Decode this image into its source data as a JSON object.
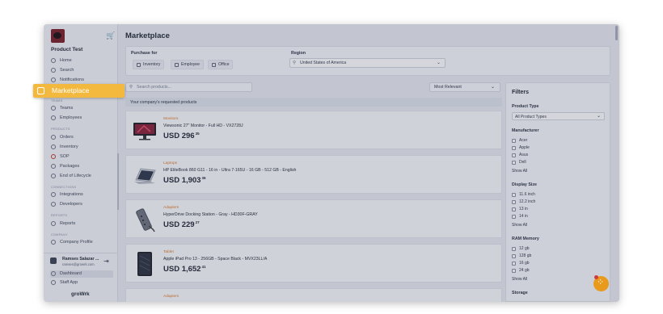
{
  "sidebar": {
    "org_name": "Product Test",
    "items_top": [
      {
        "label": "Home",
        "icon": "home-icon"
      },
      {
        "label": "Search",
        "icon": "search-icon"
      },
      {
        "label": "Notifications",
        "icon": "bell-icon"
      }
    ],
    "sections": [
      {
        "title": "TEAMS",
        "items": [
          {
            "label": "Teams",
            "icon": "people-icon"
          },
          {
            "label": "Employees",
            "icon": "user-icon"
          }
        ]
      },
      {
        "title": "PRODUCTS",
        "items": [
          {
            "label": "Orders",
            "icon": "orders-icon"
          },
          {
            "label": "Inventory",
            "icon": "laptop-icon"
          },
          {
            "label": "SOP",
            "icon": "sop-icon"
          },
          {
            "label": "Packages",
            "icon": "package-icon"
          },
          {
            "label": "End of Lifecycle",
            "icon": "cycle-icon"
          }
        ]
      },
      {
        "title": "CONNECTIONS",
        "items": [
          {
            "label": "Integrations",
            "icon": "plug-icon"
          },
          {
            "label": "Developers",
            "icon": "code-icon"
          }
        ]
      },
      {
        "title": "REPORTS",
        "items": [
          {
            "label": "Reports",
            "icon": "chart-icon"
          }
        ]
      },
      {
        "title": "COMPANY",
        "items": [
          {
            "label": "Company Profile",
            "icon": "building-icon"
          }
        ]
      }
    ],
    "user": {
      "name": "Ramses Salazar ...",
      "email": "ramses@growrk.com"
    },
    "bottom_items": [
      {
        "label": "Dashboard",
        "icon": "dashboard-icon"
      },
      {
        "label": "Staff App",
        "icon": "app-icon"
      }
    ],
    "brand": "groWrk"
  },
  "highlight": {
    "label": "Marketplace"
  },
  "main": {
    "title": "Marketplace",
    "purchase_for": {
      "label": "Purchase for",
      "options": [
        "Inventory",
        "Employee",
        "Office"
      ]
    },
    "region": {
      "label": "Region",
      "value": "United States of America"
    },
    "search_placeholder": "Search products...",
    "sort_value": "Most Relevant",
    "banner": "Your company's requested products",
    "products": [
      {
        "category": "Monitors",
        "name": "Viewsonic 27\" Monitor - Full HD - VX2728J",
        "price_main": "USD 296",
        "price_cents": "35"
      },
      {
        "category": "Laptops",
        "name": "HP EliteBook 860 G11 - 16 in - Ultra 7-165U - 16 GB - 512 GB - English",
        "price_main": "USD 1,903",
        "price_cents": "36"
      },
      {
        "category": "Adapters",
        "name": "HyperDrive Docking Station - Gray - HD30F-GRAY",
        "price_main": "USD 229",
        "price_cents": "27"
      },
      {
        "category": "Tablet",
        "name": "Apple iPad Pro 13 - 256GB - Space Black - MVX23LL/A",
        "price_main": "USD 1,652",
        "price_cents": "41"
      },
      {
        "category": "Adapters",
        "name": "",
        "price_main": "",
        "price_cents": ""
      }
    ]
  },
  "filters": {
    "title": "Filters",
    "product_type": {
      "label": "Product Type",
      "value": "All Product Types"
    },
    "groups": [
      {
        "label": "Manufacturer",
        "options": [
          "Acer",
          "Apple",
          "Asus",
          "Dell"
        ],
        "show_all": "Show All"
      },
      {
        "label": "Display Size",
        "options": [
          "11.6 inch",
          "12.2 inch",
          "13 in",
          "14 in"
        ],
        "show_all": "Show All"
      },
      {
        "label": "RAM Memory",
        "options": [
          "12 gb",
          "128 gb",
          "16 gb",
          "24 gb"
        ],
        "show_all": "Show All"
      },
      {
        "label": "Storage",
        "options": [],
        "show_all": ""
      }
    ]
  },
  "fab": {
    "badge": "1"
  },
  "colors": {
    "accent": "#f3b93e",
    "category": "#e07a2a",
    "fab": "#e79a1c"
  }
}
